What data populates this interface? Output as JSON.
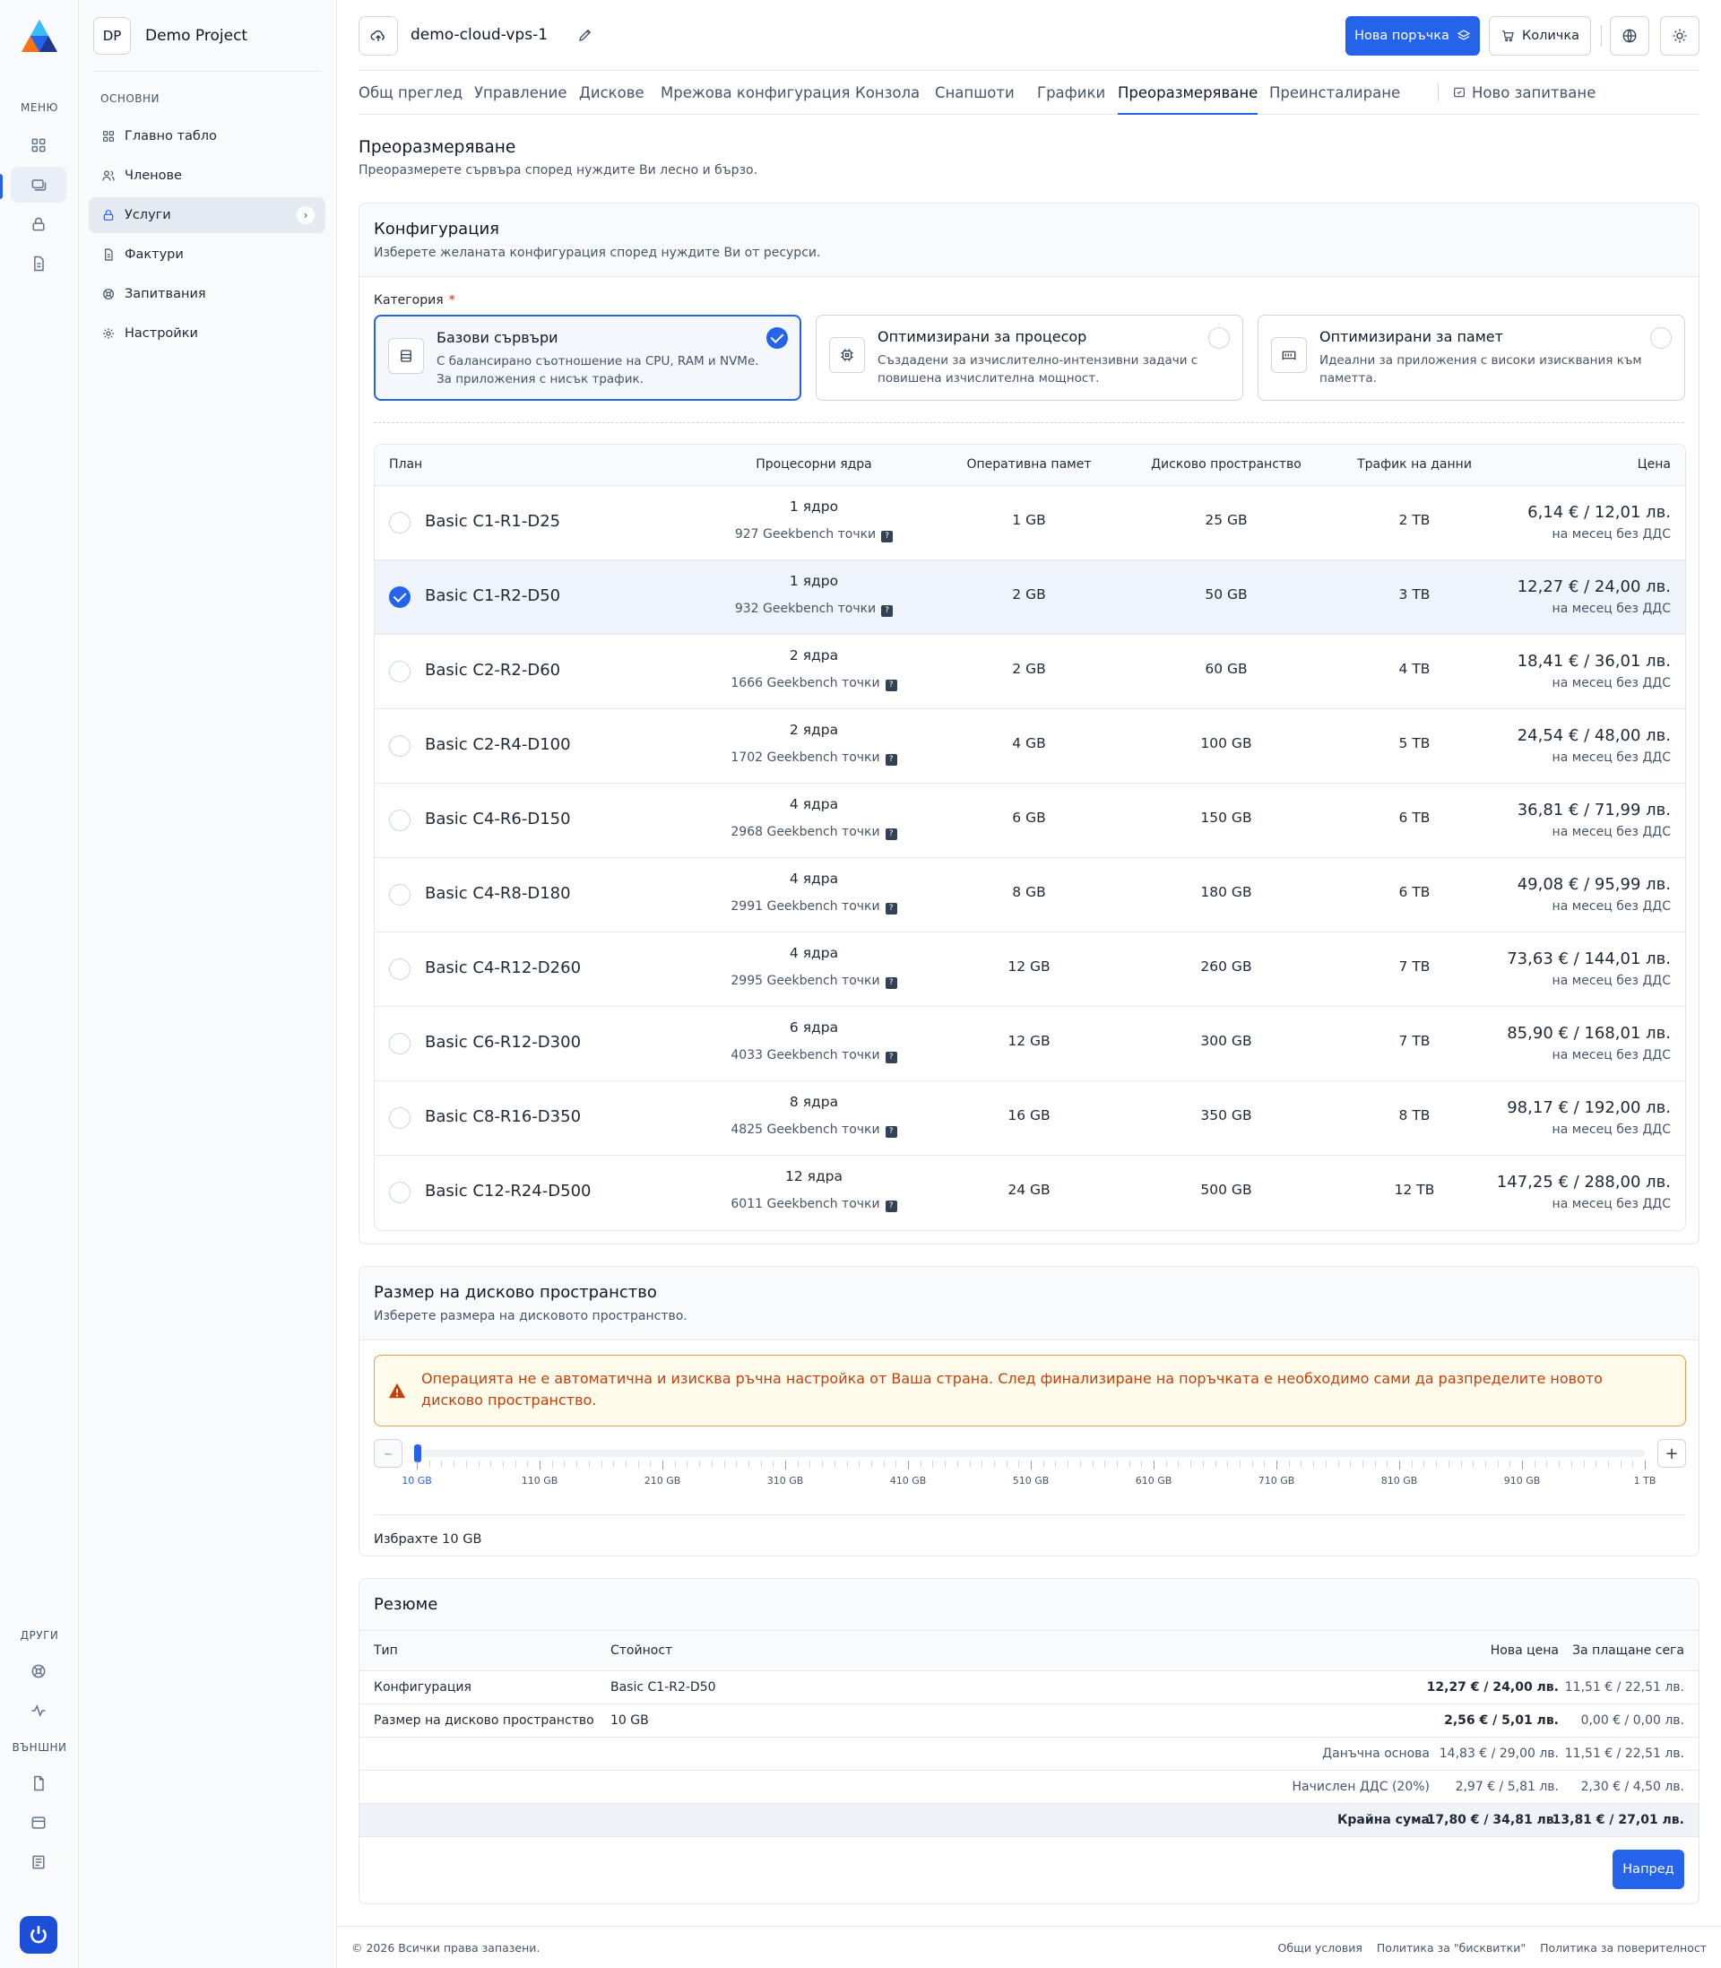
{
  "rail": {
    "menu_label": "МЕНЮ",
    "other_label": "ДРУГИ",
    "external_label": "ВЪНШНИ",
    "icons": [
      "grid-icon",
      "server-stack-icon",
      "lock-icon",
      "document-icon"
    ],
    "other_icons": [
      "lifebuoy-icon",
      "activity-icon"
    ],
    "external_icons": [
      "file-icon",
      "server-card-icon",
      "newspaper-icon"
    ]
  },
  "sidebar": {
    "project_badge": "DP",
    "project_name": "Demo Project",
    "group_label": "ОСНОВНИ",
    "items": [
      {
        "label": "Главно табло",
        "icon": "grid-icon"
      },
      {
        "label": "Членове",
        "icon": "users-icon"
      },
      {
        "label": "Услуги",
        "icon": "lock-icon",
        "active": true
      },
      {
        "label": "Фактури",
        "icon": "receipt-icon"
      },
      {
        "label": "Запитвания",
        "icon": "lifebuoy-icon"
      },
      {
        "label": "Настройки",
        "icon": "gear-icon"
      }
    ]
  },
  "header": {
    "server_name": "demo-cloud-vps-1",
    "new_order_label": "Нова поръчка",
    "cart_label": "Количка"
  },
  "tabs": [
    {
      "label": "Общ преглед"
    },
    {
      "label": "Управление"
    },
    {
      "label": "Дискове"
    },
    {
      "label": "Мрежова конфигурация"
    },
    {
      "label": "Конзола"
    },
    {
      "label": "Снапшоти"
    },
    {
      "label": "Графики"
    },
    {
      "label": "Преоразмеряване",
      "active": true
    },
    {
      "label": "Преинсталиране"
    },
    {
      "label": "Ново запитване"
    }
  ],
  "page": {
    "title": "Преоразмеряване",
    "subtitle": "Преоразмерете сървъра според нуждите Ви лесно и бързо."
  },
  "config": {
    "title": "Конфигурация",
    "subtitle": "Изберете желаната конфигурация според нуждите Ви от ресурси.",
    "category_label": "Категория",
    "required_mark": "*",
    "categories": [
      {
        "title": "Базови сървъри",
        "desc": "С балансирано съотношение на CPU, RAM и NVMe. За приложения с нисък трафик.",
        "icon": "server-icon",
        "selected": true
      },
      {
        "title": "Оптимизирани за процесор",
        "desc": "Създадени за изчислително-интензивни задачи с повишена изчислителна мощност.",
        "icon": "cpu-icon",
        "selected": false
      },
      {
        "title": "Оптимизирани за памет",
        "desc": "Идеални за приложения с високи изисквания към паметта.",
        "icon": "memory-icon",
        "selected": false
      }
    ],
    "columns": {
      "plan": "План",
      "cores": "Процесорни ядра",
      "ram": "Оперативна памет",
      "disk": "Дисково пространство",
      "traffic": "Трафик на данни",
      "price": "Цена"
    },
    "price_note": "на месец без ДДС",
    "plans": [
      {
        "name": "Basic C1-R1-D25",
        "cores": "1 ядро",
        "geek": "927 Geekbench точки",
        "ram": "1 GB",
        "disk": "25 GB",
        "traffic": "2 TB",
        "price": "6,14 € / 12,01 лв."
      },
      {
        "name": "Basic C1-R2-D50",
        "cores": "1 ядро",
        "geek": "932 Geekbench точки",
        "ram": "2 GB",
        "disk": "50 GB",
        "traffic": "3 TB",
        "price": "12,27 € / 24,00 лв.",
        "selected": true
      },
      {
        "name": "Basic C2-R2-D60",
        "cores": "2 ядра",
        "geek": "1666 Geekbench точки",
        "ram": "2 GB",
        "disk": "60 GB",
        "traffic": "4 TB",
        "price": "18,41 € / 36,01 лв."
      },
      {
        "name": "Basic C2-R4-D100",
        "cores": "2 ядра",
        "geek": "1702 Geekbench точки",
        "ram": "4 GB",
        "disk": "100 GB",
        "traffic": "5 TB",
        "price": "24,54 € / 48,00 лв."
      },
      {
        "name": "Basic C4-R6-D150",
        "cores": "4 ядра",
        "geek": "2968 Geekbench точки",
        "ram": "6 GB",
        "disk": "150 GB",
        "traffic": "6 TB",
        "price": "36,81 € / 71,99 лв."
      },
      {
        "name": "Basic C4-R8-D180",
        "cores": "4 ядра",
        "geek": "2991 Geekbench точки",
        "ram": "8 GB",
        "disk": "180 GB",
        "traffic": "6 TB",
        "price": "49,08 € / 95,99 лв."
      },
      {
        "name": "Basic C4-R12-D260",
        "cores": "4 ядра",
        "geek": "2995 Geekbench точки",
        "ram": "12 GB",
        "disk": "260 GB",
        "traffic": "7 TB",
        "price": "73,63 € / 144,01 лв."
      },
      {
        "name": "Basic C6-R12-D300",
        "cores": "6 ядра",
        "geek": "4033 Geekbench точки",
        "ram": "12 GB",
        "disk": "300 GB",
        "traffic": "7 TB",
        "price": "85,90 € / 168,01 лв."
      },
      {
        "name": "Basic C8-R16-D350",
        "cores": "8 ядра",
        "geek": "4825 Geekbench точки",
        "ram": "16 GB",
        "disk": "350 GB",
        "traffic": "8 TB",
        "price": "98,17 € / 192,00 лв."
      },
      {
        "name": "Basic C12-R24-D500",
        "cores": "12 ядра",
        "geek": "6011 Geekbench точки",
        "ram": "24 GB",
        "disk": "500 GB",
        "traffic": "12 TB",
        "price": "147,25 € / 288,00 лв."
      }
    ]
  },
  "disk": {
    "title": "Размер на дисково пространство",
    "subtitle": "Изберете размера на дисковото пространство.",
    "warning": "Операцията не е автоматична и изисква ръчна настройка от Ваша страна. След финализиране на поръчката е необходимо сами да разпределите новото дисково пространство.",
    "minus": "–",
    "plus": "+",
    "tick_labels": [
      "10 GB",
      "110 GB",
      "210 GB",
      "310 GB",
      "410 GB",
      "510 GB",
      "610 GB",
      "710 GB",
      "810 GB",
      "910 GB",
      "1 TB"
    ],
    "selected_value_fraction": 0,
    "chosen_text": "Избрахте 10 GB"
  },
  "summary": {
    "title": "Резюме",
    "columns": {
      "type": "Тип",
      "value": "Стойност",
      "new_price": "Нова цена",
      "pay_now": "За плащане сега"
    },
    "rows": [
      {
        "type": "Конфигурация",
        "value": "Basic C1-R2-D50",
        "new_price": "12,27 € / 24,00 лв.",
        "pay_now": "11,51 € / 22,51 лв."
      },
      {
        "type": "Размер на дисково пространство",
        "value": "10 GB",
        "new_price": "2,56 € / 5,01 лв.",
        "pay_now": "0,00 € / 0,00 лв."
      }
    ],
    "tax_base": {
      "label": "Данъчна основа",
      "new_price": "14,83 € / 29,00 лв.",
      "pay_now": "11,51 € / 22,51 лв."
    },
    "vat": {
      "label": "Начислен ДДС (20%)",
      "new_price": "2,97 € / 5,81 лв.",
      "pay_now": "2,30 € / 4,50 лв."
    },
    "total": {
      "label": "Крайна сума",
      "new_price": "17,80 € / 34,81 лв.",
      "pay_now": "13,81 € / 27,01 лв."
    },
    "next_label": "Напред"
  },
  "footer": {
    "copyright": "© 2026 Всички права запазени.",
    "links": [
      "Общи условия",
      "Политика за \"бисквитки\"",
      "Политика за поверителност"
    ]
  },
  "colors": {
    "accent": "#2563eb",
    "warning_border": "#ea9a4a",
    "warning_text": "#c2410c"
  }
}
